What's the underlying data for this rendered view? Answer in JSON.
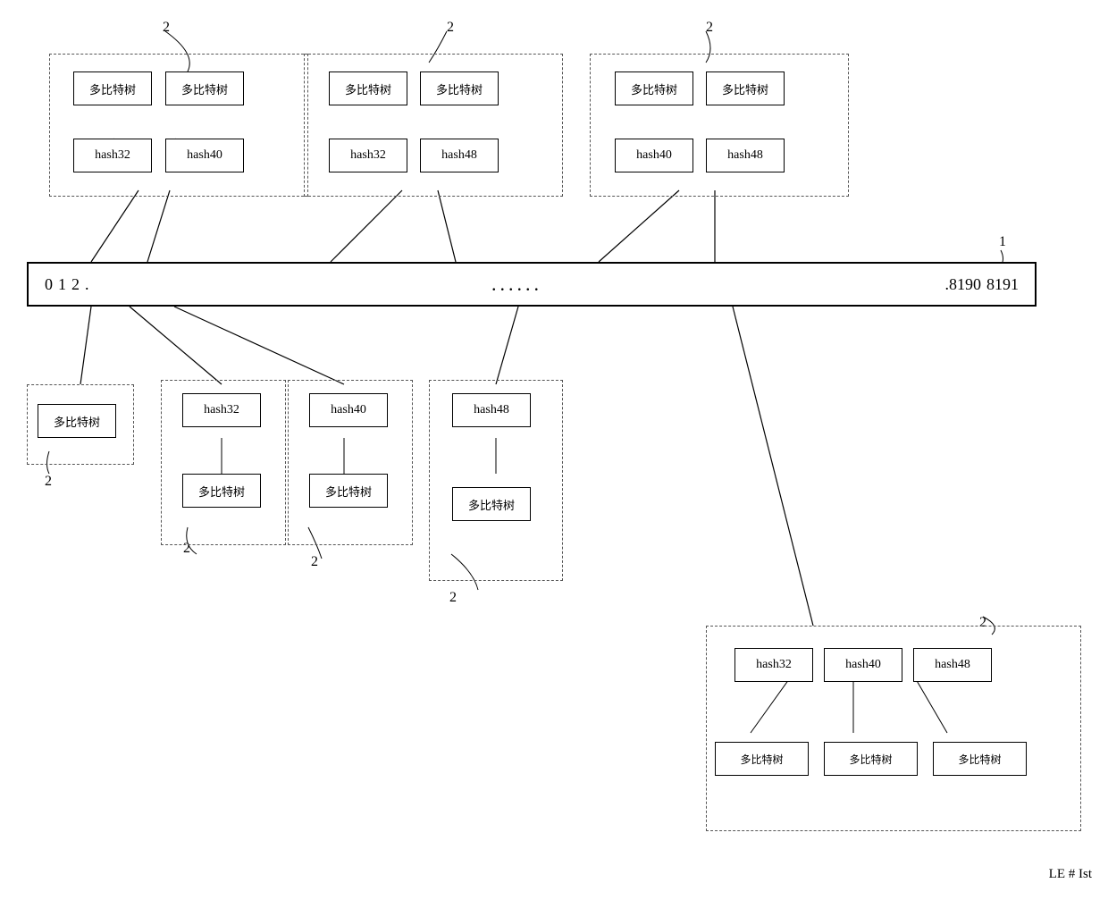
{
  "labels": {
    "duobiteshu": "多比特树",
    "hash32": "hash32",
    "hash40": "hash40",
    "hash48": "hash48",
    "label2": "2",
    "label1": "1",
    "mainbar": {
      "left": [
        "0",
        "1",
        "2",
        "."
      ],
      "dots": "......",
      "right": [
        ".8190",
        "8191"
      ]
    },
    "bottom_right": "LE # Ist"
  }
}
